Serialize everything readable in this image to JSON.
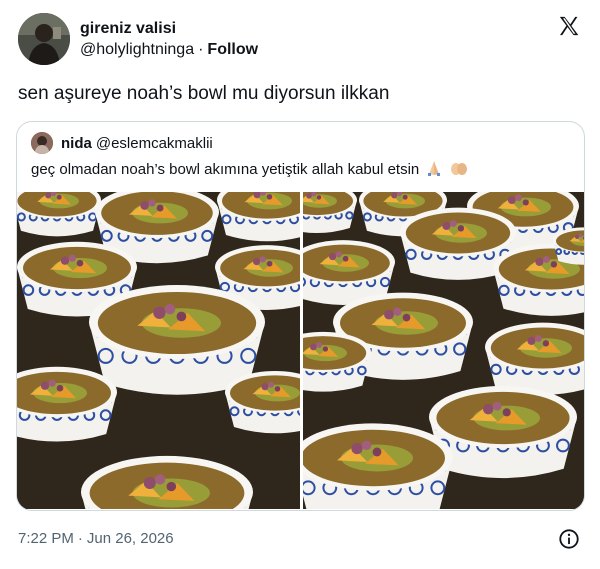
{
  "tweet": {
    "author_name": "gireniz valisi",
    "author_handle": "@holylightninga",
    "separator": "·",
    "follow_label": "Follow",
    "text": "sen aşureye noah’s bowl mu diyorsun ilkkan",
    "time": "7:22 PM",
    "date": "Jun 26, 2026"
  },
  "quote": {
    "author_name": "nida",
    "author_handle": "@eslemcakmaklii",
    "text": "geç olmadan noah’s bowl akımına yetiştik allah kabul etsin"
  },
  "icons": {
    "brand": "x-logo-icon",
    "info": "info-circle-icon",
    "emoji_1": "folded-hands-emoji",
    "emoji_2": "palms-up-emoji"
  },
  "colors": {
    "text": "#0f1419",
    "muted": "#536471",
    "border": "#cfd9de",
    "bowl_blue": "#2c4fa3",
    "ashure": "#8b6a2c",
    "apricot": "#e59a2a"
  }
}
